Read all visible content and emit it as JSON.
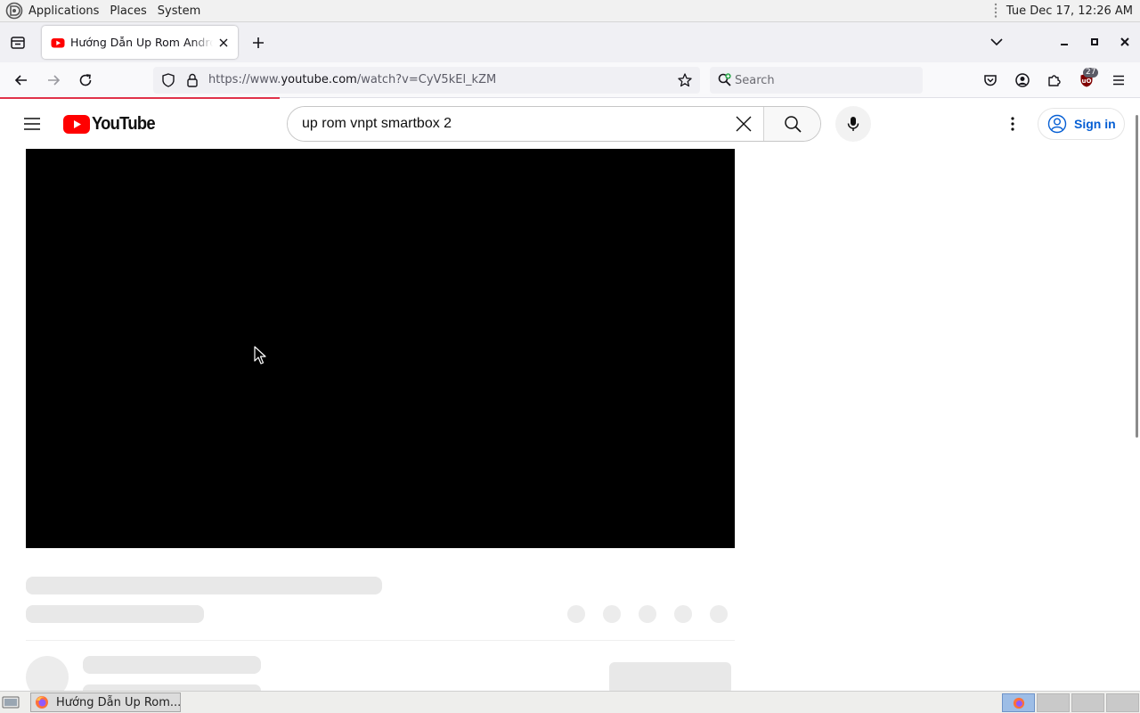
{
  "system_panel": {
    "menus": [
      "Applications",
      "Places",
      "System"
    ],
    "clock": "Tue Dec 17, 12:26 AM"
  },
  "browser": {
    "tab": {
      "title": "Hướng Dẫn Up Rom Android",
      "favicon": "youtube-favicon"
    },
    "url": {
      "prefix": "https://www.",
      "host": "youtube.com",
      "path": "/watch?v=CyV5kEl_kZM"
    },
    "search_placeholder": "Search",
    "extension_badge": "27",
    "load_progress_percent": 24.5
  },
  "youtube": {
    "logo_text": "YouTube",
    "search_query": "up rom vnpt smartbox 2",
    "sign_in_label": "Sign in"
  },
  "taskbar": {
    "window_title": "Hướng Dẫn Up Rom...",
    "workspaces": 4,
    "active_workspace": 1
  },
  "colors": {
    "youtube_red": "#ff0000",
    "link_blue": "#065fd4",
    "progress_red": "#e0324a",
    "player_black": "#000000"
  }
}
